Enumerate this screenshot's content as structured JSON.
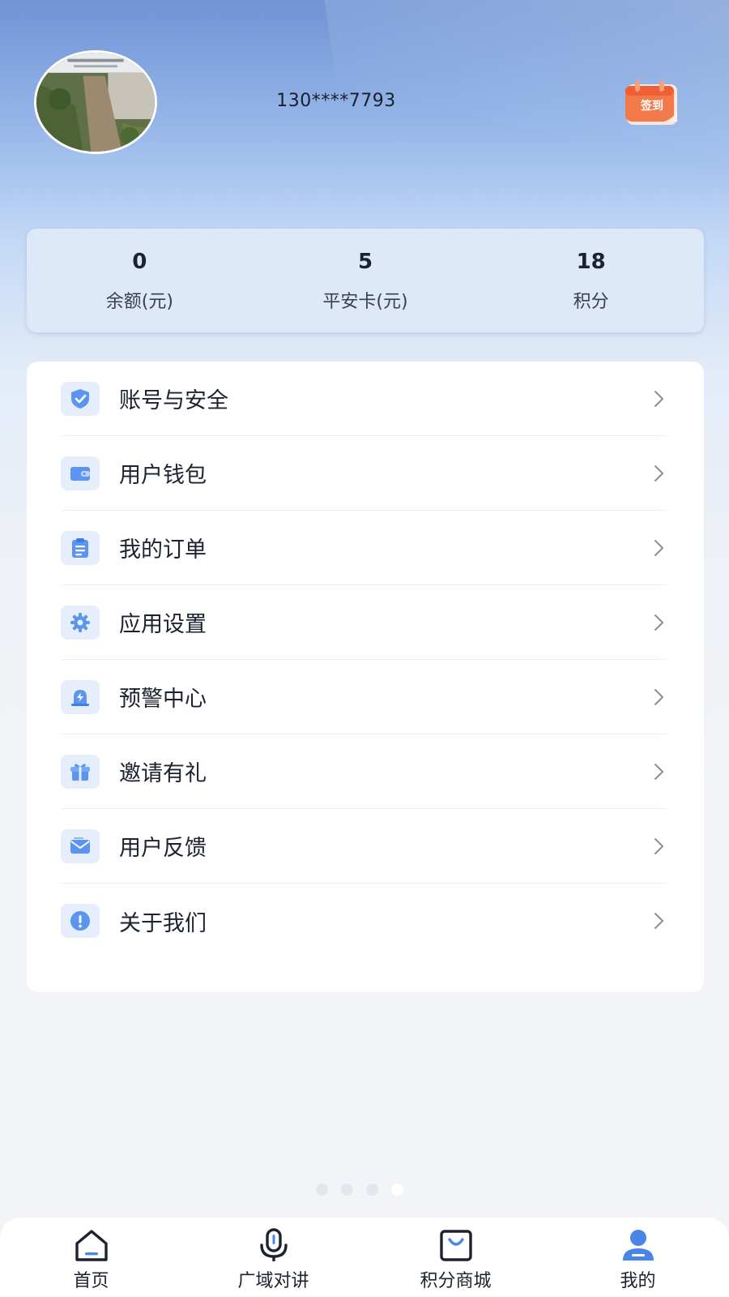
{
  "header": {
    "phone": "130****7793",
    "checkin_label": "签到",
    "avatar_icon": "avatar-photo"
  },
  "stats": [
    {
      "value": "0",
      "label": "余额(元)"
    },
    {
      "value": "5",
      "label": "平安卡(元)"
    },
    {
      "value": "18",
      "label": "积分"
    }
  ],
  "menu": [
    {
      "label": "账号与安全",
      "icon": "shield-check-icon"
    },
    {
      "label": "用户钱包",
      "icon": "wallet-icon"
    },
    {
      "label": "我的订单",
      "icon": "clipboard-icon"
    },
    {
      "label": "应用设置",
      "icon": "gear-icon"
    },
    {
      "label": "预警中心",
      "icon": "alarm-icon"
    },
    {
      "label": "邀请有礼",
      "icon": "gift-icon"
    },
    {
      "label": "用户反馈",
      "icon": "envelope-icon"
    },
    {
      "label": "关于我们",
      "icon": "info-icon"
    }
  ],
  "pager": {
    "count": 4,
    "active_index": 3
  },
  "tabbar": [
    {
      "label": "首页",
      "icon": "home-icon",
      "active": false
    },
    {
      "label": "广域对讲",
      "icon": "microphone-icon",
      "active": false
    },
    {
      "label": "积分商城",
      "icon": "shopping-bag-icon",
      "active": false
    },
    {
      "label": "我的",
      "icon": "user-icon",
      "active": true
    }
  ],
  "colors": {
    "accent": "#4a86e8",
    "icon_bg": "#e6eefb",
    "checkin": "#f2794a"
  }
}
